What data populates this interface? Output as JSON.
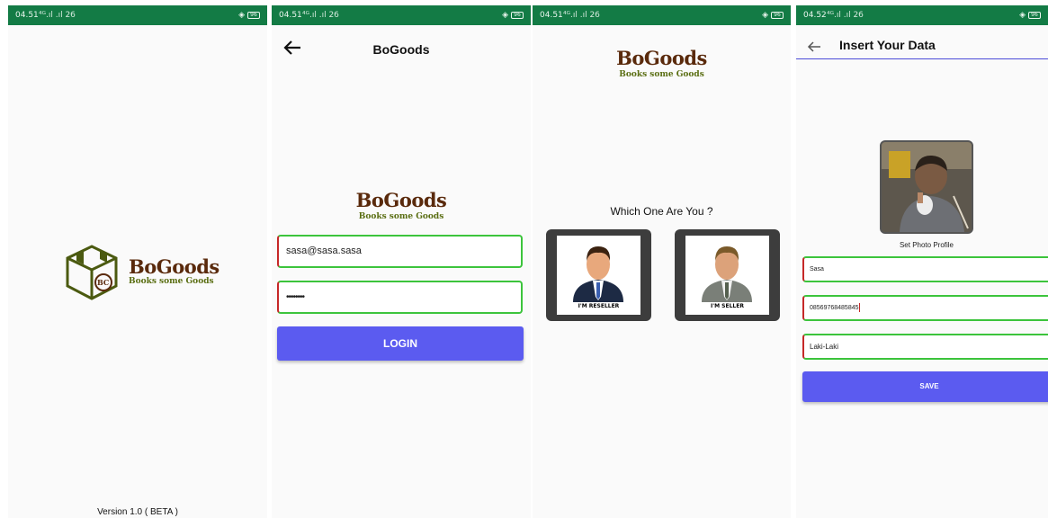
{
  "screen1": {
    "status": {
      "time": "04.51",
      "signal": "⁴ᴳ.ıl .ıl 26",
      "battery": "96"
    },
    "logo": {
      "name": "BoGoods",
      "tagline": "Books some Goods",
      "box_text": "BC"
    },
    "version": "Version 1.0 ( BETA )"
  },
  "screen2": {
    "status": {
      "time": "04.51",
      "signal": "⁴ᴳ.ıl .ıl 26",
      "battery": "96"
    },
    "appbar": {
      "title": "BoGoods",
      "back_icon": "arrow-left-icon"
    },
    "logo": {
      "name": "BoGoods",
      "tagline": "Books some Goods"
    },
    "email_value": "sasa@sasa.sasa",
    "password_value": "••••••••",
    "login_label": "LOGIN"
  },
  "screen3": {
    "status": {
      "time": "04.51",
      "signal": "⁴ᴳ.ıl .ıl 26",
      "battery": "96"
    },
    "logo": {
      "name": "BoGoods",
      "tagline": "Books some Goods"
    },
    "question": "Which One Are You ?",
    "reseller_label": "I'M RESELLER",
    "seller_label": "I'M SELLER"
  },
  "screen4": {
    "status": {
      "time": "04.52",
      "signal": "⁴ᴳ.ıl .ıl 26",
      "battery": "96"
    },
    "appbar": {
      "title": "Insert Your Data",
      "back_icon": "arrow-left-icon"
    },
    "photo_caption": "Set Photo Profile",
    "name_value": "Sasa",
    "phone_value": "08569768485845",
    "gender_value": "Laki-Laki",
    "save_label": "SAVE"
  },
  "colors": {
    "status_bar": "#137b45",
    "button": "#5b5bf0",
    "logo_brown": "#5a2a0c",
    "logo_green": "#5a6e12",
    "field_border_red": "#c62828",
    "field_border_green": "#3cc43c",
    "appbar_line": "#4b4bd8"
  }
}
